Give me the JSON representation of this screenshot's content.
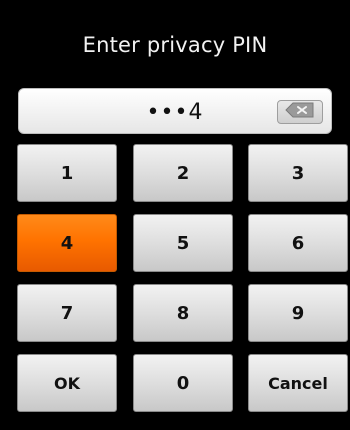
{
  "dialog": {
    "title": "Enter privacy PIN"
  },
  "pin_field": {
    "value": "•••4",
    "backspace_icon": "backspace-icon"
  },
  "keypad": {
    "keys": [
      "1",
      "2",
      "3",
      "4",
      "5",
      "6",
      "7",
      "8",
      "9",
      "OK",
      "0",
      "Cancel"
    ],
    "pressed_key": "4",
    "pressed_color": "#ff7300"
  }
}
